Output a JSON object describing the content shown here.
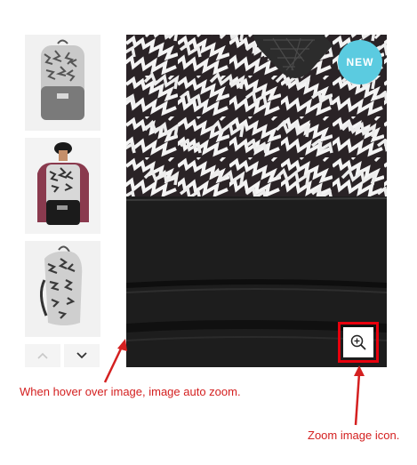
{
  "product": {
    "badge": "NEW",
    "thumbnails": [
      {
        "alt": "backpack-front-view"
      },
      {
        "alt": "backpack-worn-by-model"
      },
      {
        "alt": "backpack-side-view"
      }
    ],
    "zoom_icon": "zoom-in-icon",
    "prev_icon": "chevron-up-icon",
    "next_icon": "chevron-down-icon"
  },
  "annotations": {
    "hover": "When hover over image, image auto zoom.",
    "zoom": "Zoom image icon."
  },
  "colors": {
    "badge": "#5bcbe0",
    "annotation": "#d42020",
    "highlight": "#e8000d",
    "bag_black": "#141414",
    "burgundy": "#8a3a4e"
  }
}
